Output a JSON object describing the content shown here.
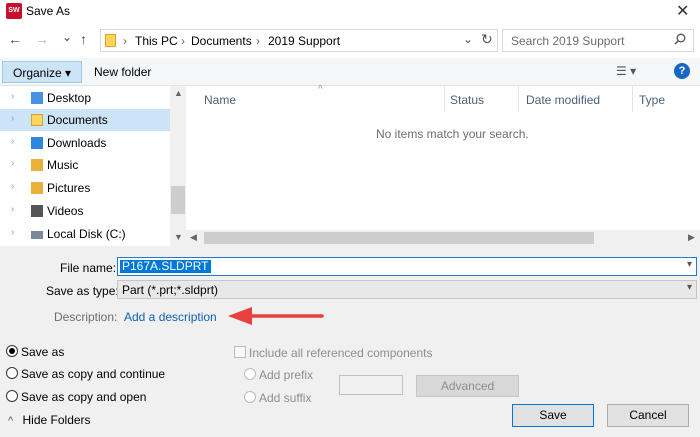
{
  "window": {
    "title": "Save As",
    "app_icon_text": "SW",
    "close_glyph": "✕"
  },
  "nav_buttons": {
    "back": "←",
    "forward": "→",
    "recent": "⌄",
    "up": "↑"
  },
  "address": {
    "crumbs": [
      "This PC",
      "Documents",
      "2019 Support"
    ],
    "separator": "›",
    "refresh_glyph": "↻",
    "dropdown_glyph": "⌄"
  },
  "search": {
    "placeholder": "Search 2019 Support",
    "icon": "search-icon"
  },
  "toolbar": {
    "organize_label": "Organize ▾",
    "new_folder_label": "New folder",
    "view_glyph": "☰ ▾",
    "help_glyph": "?"
  },
  "nav_pane": {
    "items": [
      {
        "label": "Desktop",
        "icon": "desktop-folder-icon",
        "color": "#4a90e2",
        "selected": false
      },
      {
        "label": "Documents",
        "icon": "documents-folder-icon",
        "color": "#ffd35c",
        "selected": true
      },
      {
        "label": "Downloads",
        "icon": "downloads-folder-icon",
        "color": "#2e86de",
        "selected": false
      },
      {
        "label": "Music",
        "icon": "music-folder-icon",
        "color": "#e8b23a",
        "selected": false
      },
      {
        "label": "Pictures",
        "icon": "pictures-folder-icon",
        "color": "#e8b23a",
        "selected": false
      },
      {
        "label": "Videos",
        "icon": "videos-folder-icon",
        "color": "#555555",
        "selected": false
      },
      {
        "label": "Local Disk (C:)",
        "icon": "local-disk-icon",
        "color": "#7b8a99",
        "selected": false
      }
    ],
    "chevron": "›"
  },
  "file_list": {
    "columns": [
      "Name",
      "Status",
      "Date modified",
      "Type"
    ],
    "sort_glyph": "^",
    "empty_message": "No items match your search."
  },
  "form": {
    "file_name_label": "File name:",
    "file_name_value": "P167A.SLDPRT",
    "save_as_type_label": "Save as type:",
    "save_as_type_value": "Part (*.prt;*.sldprt)",
    "description_label": "Description:",
    "add_description_link": "Add a description"
  },
  "options": {
    "save_modes": [
      {
        "label": "Save as",
        "checked": true
      },
      {
        "label": "Save as copy and continue",
        "checked": false
      },
      {
        "label": "Save as copy and open",
        "checked": false
      }
    ],
    "include_all_label": "Include all referenced components",
    "add_prefix_label": "Add prefix",
    "add_suffix_label": "Add suffix",
    "advanced_label": "Advanced"
  },
  "footer": {
    "hide_folders_label": "Hide Folders",
    "hide_glyph": "^",
    "save_label": "Save",
    "cancel_label": "Cancel"
  },
  "colors": {
    "accent": "#0078d7",
    "selection": "#cce4f7",
    "link": "#0b63b5",
    "annotation_arrow": "#e8403c"
  }
}
